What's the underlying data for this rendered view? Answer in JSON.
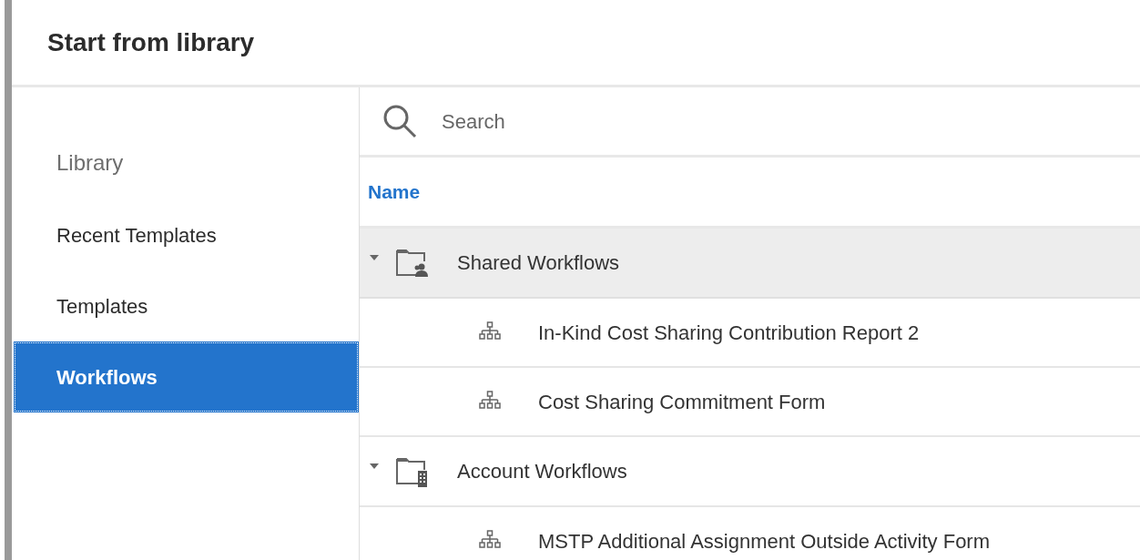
{
  "dialog": {
    "title": "Start from library"
  },
  "sidebar": {
    "heading": "Library",
    "items": [
      {
        "label": "Recent Templates",
        "selected": false
      },
      {
        "label": "Templates",
        "selected": false
      },
      {
        "label": "Workflows",
        "selected": true
      }
    ]
  },
  "search": {
    "placeholder": "Search"
  },
  "table": {
    "columns": [
      "Name"
    ],
    "groups": [
      {
        "name": "Shared Workflows",
        "kind": "shared",
        "expanded": true,
        "selected": true,
        "children": [
          {
            "name": "In-Kind Cost Sharing Contribution Report 2"
          },
          {
            "name": "Cost Sharing Commitment Form"
          }
        ]
      },
      {
        "name": "Account Workflows",
        "kind": "account",
        "expanded": true,
        "selected": false,
        "children": [
          {
            "name": "MSTP Additional Assignment Outside Activity Form"
          }
        ]
      }
    ]
  }
}
